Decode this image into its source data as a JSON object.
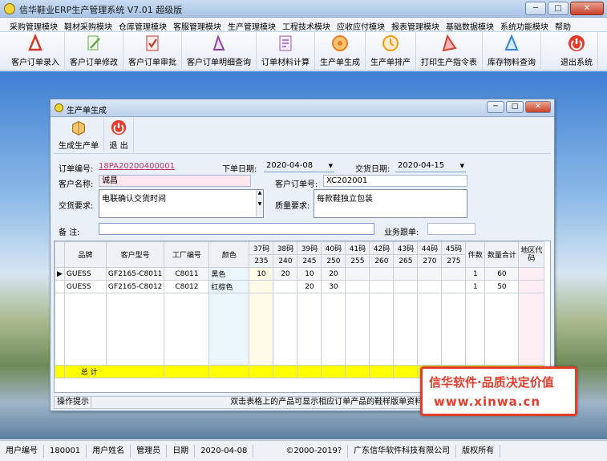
{
  "window": {
    "title": "信华鞋业ERP生产管理系统   V7.01  超级版",
    "btn_min": "─",
    "btn_max": "□",
    "btn_close": "✕"
  },
  "menu": [
    "采购管理模块",
    "鞋材采购模块",
    "仓库管理模块",
    "客服管理模块",
    "生产管理模块",
    "工程技术模块",
    "应收应付模块",
    "报表管理模块",
    "基础数据模块",
    "系统功能模块",
    "帮助"
  ],
  "toolbar": [
    {
      "label": "客户订单录入",
      "icon": "pdf-icon",
      "color": "#d23a2a"
    },
    {
      "label": "客户订单修改",
      "icon": "edit-icon",
      "color": "#6aa84f"
    },
    {
      "label": "客户订单审批",
      "icon": "approve-icon",
      "color": "#c0392b"
    },
    {
      "label": "客户订单明细查询",
      "icon": "query-icon",
      "color": "#8e44ad"
    },
    {
      "label": "订单材料计算",
      "icon": "calc-icon",
      "color": "#9b59b6"
    },
    {
      "label": "生产单生成",
      "icon": "generate-icon",
      "color": "#e67e22"
    },
    {
      "label": "生产单排产",
      "icon": "schedule-icon",
      "color": "#f39c12"
    },
    {
      "label": "打印生产指令表",
      "icon": "print-icon",
      "color": "#d4412f"
    },
    {
      "label": "库存物料查询",
      "icon": "stock-icon",
      "color": "#2e86de"
    },
    {
      "label": "退出系统",
      "icon": "exit-icon",
      "color": "#e23c2b"
    }
  ],
  "child": {
    "title": "生产单生成",
    "tools": [
      {
        "label": "生成生产单",
        "icon": "book-icon"
      },
      {
        "label": "退 出",
        "icon": "exit-icon"
      }
    ]
  },
  "form": {
    "order_no_label": "订单编号:",
    "order_no": "18PA20200400001",
    "order_date_label": "下单日期:",
    "order_date": "2020-04-08",
    "delivery_date_label": "交货日期:",
    "delivery_date": "2020-04-15",
    "customer_label": "客户名称:",
    "customer": "诚昌",
    "cust_order_label": "客户订单号:",
    "cust_order": "XC202001",
    "delivery_req_label": "交货要求:",
    "delivery_req": "电联确认交货时间",
    "quality_req_label": "质量要求:",
    "quality_req": "每款鞋独立包装",
    "remark_label": "备   注:",
    "remark": "",
    "sales_label": "业务跟单:",
    "sales": ""
  },
  "grid": {
    "headers": [
      "品牌",
      "客户型号",
      "工厂编号",
      "颜色"
    ],
    "sizes": [
      "37码",
      "38码",
      "39码",
      "40码",
      "41码",
      "42码",
      "43码",
      "44码",
      "45码"
    ],
    "size_nums": [
      "235",
      "240",
      "245",
      "250",
      "255",
      "260",
      "265",
      "270",
      "275"
    ],
    "tail_headers": [
      "件数",
      "数量合计",
      "地区代码"
    ],
    "rows": [
      {
        "brand": "GUESS",
        "model": "GF2165-C8011",
        "factory": "C8011",
        "color": "黑色",
        "q": [
          "10",
          "20",
          "10",
          "20",
          "",
          "",
          "",
          "",
          ""
        ],
        "pieces": "1",
        "total": "60",
        "area": ""
      },
      {
        "brand": "GUESS",
        "model": "GF2165-C8012",
        "factory": "C8012",
        "color": "红棕色",
        "q": [
          "",
          "",
          "20",
          "30",
          "",
          "",
          "",
          "",
          ""
        ],
        "pieces": "1",
        "total": "50",
        "area": ""
      }
    ],
    "total_label": "总 计"
  },
  "hint": {
    "label": "操作提示",
    "text": "双击表格上的产品可显示相应订单产品的鞋样版单资料!"
  },
  "stamp": {
    "line1": "信华软件·品质决定价值",
    "line2": "www.xinwa.cn"
  },
  "status": [
    {
      "label": "用户编号"
    },
    {
      "label": "180001"
    },
    {
      "label": "用户姓名"
    },
    {
      "label": "管理员"
    },
    {
      "label": "日期"
    },
    {
      "label": "2020-04-08"
    },
    {
      "label": "©2000-2019?"
    },
    {
      "label": "广东信华软件科技有限公司"
    },
    {
      "label": "版权所有"
    }
  ]
}
